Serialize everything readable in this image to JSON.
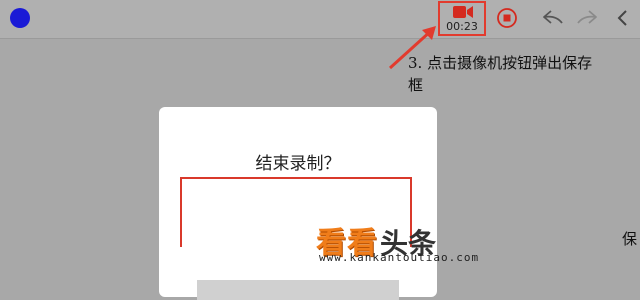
{
  "toolbar": {
    "record_timer": "00:23",
    "icons": {
      "status": "status-dot-icon",
      "camera": "video-camera-icon",
      "stop": "stop-record-icon",
      "undo": "undo-icon",
      "redo": "redo-icon",
      "back": "chevron-left-icon"
    }
  },
  "annotation": {
    "line1": "3. 点击摄像机按钮弹出保存",
    "line2": "框"
  },
  "dialog": {
    "title": "结束录制？"
  },
  "watermark": {
    "brand_orange": "看看",
    "brand_dark": "头条",
    "url": "www.kankantoutiao.com"
  },
  "edge_text": {
    "right_glyph": "保"
  },
  "colors": {
    "accent_red": "#e23b2e",
    "dot_blue": "#1a1ad6",
    "watermark_orange": "#f07d1a"
  }
}
